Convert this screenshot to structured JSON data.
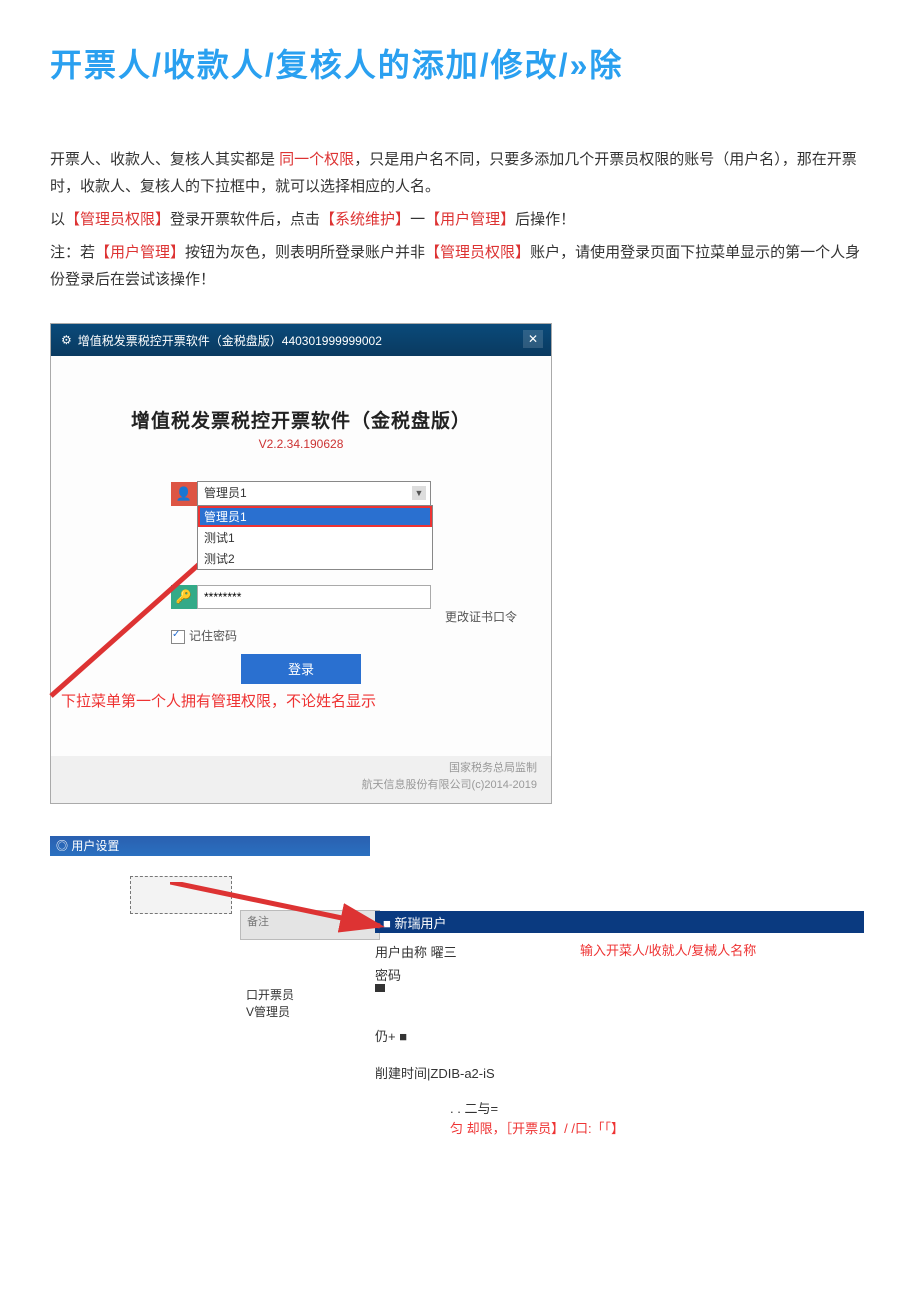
{
  "title": "开票人/收款人/复核人的添加/修改/»除",
  "p1a": "开票人、收款人、复核人其实都是 ",
  "p1_red": "同一个权限",
  "p1b": "，只是用户名不同，只要多添加几个开票员权限的账号（用户名），那在开票时，收款人、复核人的下拉框中，就可以选择相应的人名。",
  "p2a": "以",
  "p2_r1": "【管理员权限】",
  "p2b": "登录开票软件后，点击",
  "p2_r2": "【系统维护】",
  "p2c": "一",
  "p2_r3": "【用户管理】",
  "p2d": "后操作！",
  "p3a": "注：若",
  "p3_r1": "【用户管理】",
  "p3b": "按钮为灰色，则表明所登录账户并非",
  "p3_r2": "【管理员权限】",
  "p3c": "账户，请使用登录页面下拉菜单显示的第一个人身份登录后在尝试该操作！",
  "shot1": {
    "titlebar": "增值税发票税控开票软件（金税盘版）440301999999002",
    "appname": "增值税发票税控开票软件（金税盘版）",
    "version": "V2.2.34.190628",
    "dropdown_selected": "管理员1",
    "dropdown_options": [
      "管理员1",
      "测试1",
      "测试2"
    ],
    "pwd_mask": "********",
    "change_cert": "更改证书口令",
    "remember": "记住密码",
    "login": "登录",
    "annotation": "下拉菜单第一个人拥有管理权限，不论姓名显示",
    "gov1": "国家税务总局监制",
    "gov2": "航天信息股份有限公司(c)2014-2019"
  },
  "shot2": {
    "titlebar": "◎ 用户设置",
    "gray_label": "备注",
    "blue_header": "■ 新瑞用户",
    "name_label": "用户由称 曜三",
    "red_annot_a": "输入开菜人/收就人/复械人名称",
    "pwd_label": "密码",
    "role1": "口开票员",
    "role2": "V管理员",
    "note_label": "仍+ ■",
    "create_label": "削建时间|ZDIB-a2-iS",
    "eq": ". . 二与=",
    "red_annot_b": "匀 却限，［开票员】/ /口:「「】"
  }
}
